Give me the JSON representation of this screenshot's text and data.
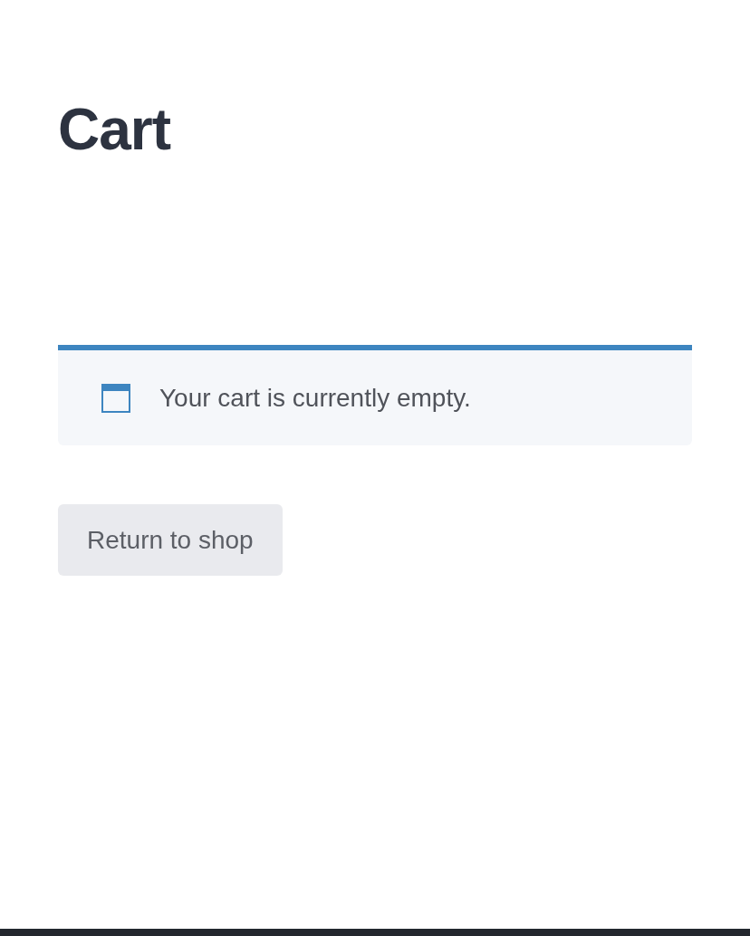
{
  "page": {
    "title": "Cart"
  },
  "notice": {
    "message": "Your cart is currently empty."
  },
  "buttons": [
    {
      "label": "Return to shop"
    }
  ]
}
